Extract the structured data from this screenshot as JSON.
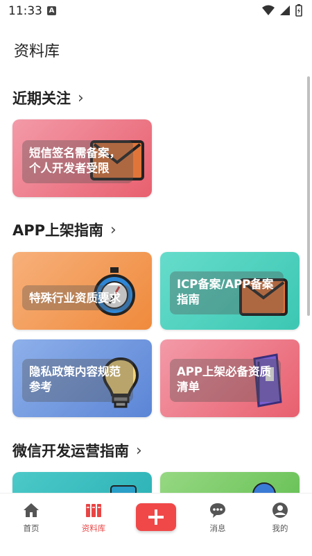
{
  "status": {
    "time": "11:33",
    "a_badge": "A"
  },
  "page_title": "资料库",
  "sections": [
    {
      "title": "近期关注",
      "cards": [
        {
          "label": "短信签名需备案，个人开发者受限",
          "icon": "envelope-icon",
          "color_start": "#f08a9a",
          "color_end": "#e85a6e"
        }
      ]
    },
    {
      "title": "APP上架指南",
      "cards": [
        {
          "label": "特殊行业资质要求",
          "icon": "stopwatch-icon",
          "color_start": "#f6a86a",
          "color_end": "#ef8a3c"
        },
        {
          "label": "ICP备案/APP备案指南",
          "icon": "envelope-icon",
          "color_start": "#5fd8c6",
          "color_end": "#3cc7b3"
        },
        {
          "label": "隐私政策内容规范参考",
          "icon": "lightbulb-icon",
          "color_start": "#86a9e6",
          "color_end": "#5b85d6"
        },
        {
          "label": "APP上架必备资质清单",
          "icon": "binder-icon",
          "color_start": "#f08a9a",
          "color_end": "#e85a6e"
        }
      ]
    },
    {
      "title": "微信开发运营指南",
      "cards": [
        {
          "icon": "card-icon",
          "color_start": "#4cc9c8",
          "color_end": "#2fb4b8"
        },
        {
          "icon": "globe-icon",
          "color_start": "#8fd47a",
          "color_end": "#6cc35a"
        }
      ]
    }
  ],
  "tabbar": {
    "items": [
      {
        "label": "首页",
        "icon": "home-icon"
      },
      {
        "label": "资料库",
        "icon": "library-icon",
        "active": true
      },
      {
        "label": "",
        "icon": "plus-icon"
      },
      {
        "label": "消息",
        "icon": "chat-icon"
      },
      {
        "label": "我的",
        "icon": "profile-icon"
      }
    ],
    "active_color": "#e84545"
  }
}
